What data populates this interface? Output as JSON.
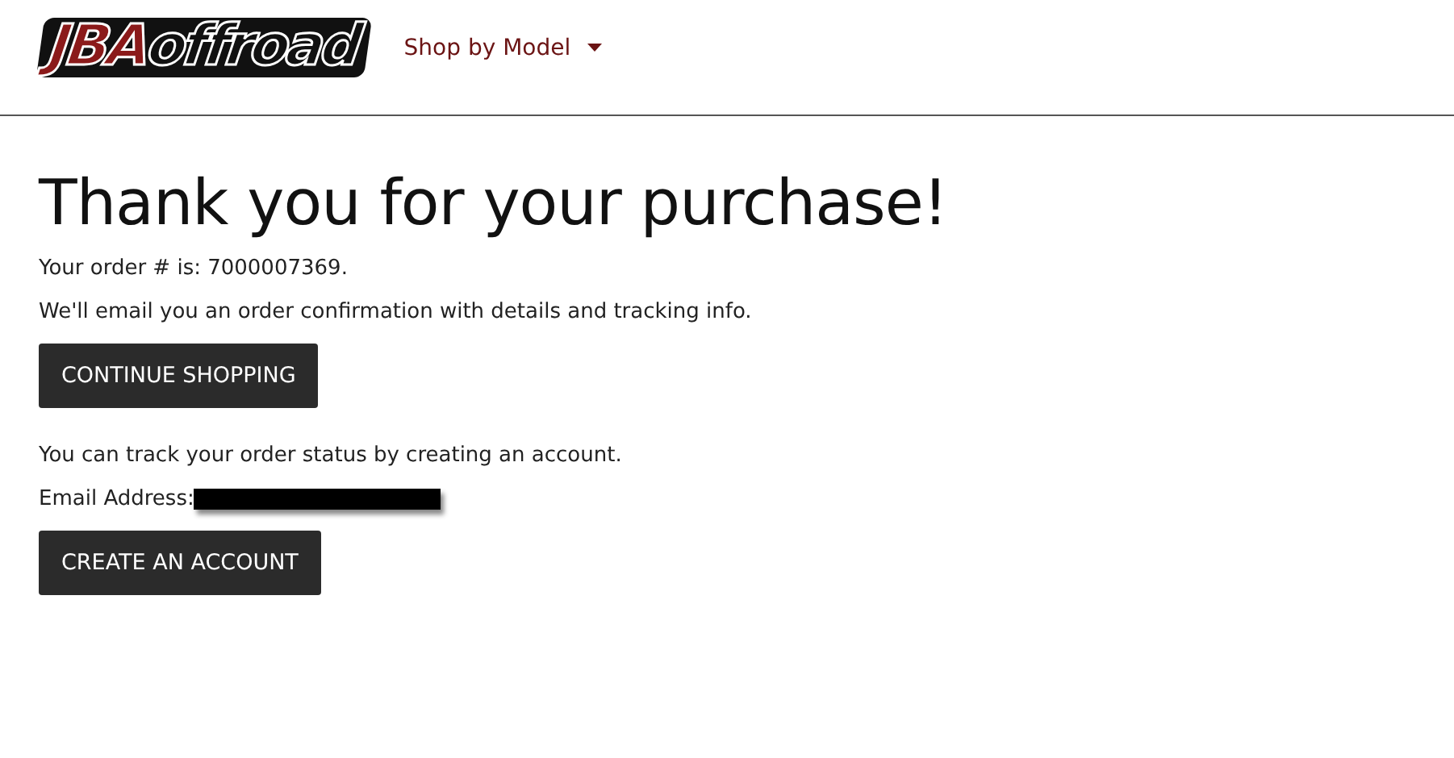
{
  "header": {
    "logo": {
      "accent": "JBA",
      "rest": "offroad"
    },
    "nav": [
      {
        "label": "Shop by Model",
        "has_menu": true
      }
    ]
  },
  "heading": "Thank you for your purchase!",
  "order_line": "Your order # is: 7000007369.",
  "email_note": "We'll email you an order confirmation with details and tracking info.",
  "continue_button": "CONTINUE SHOPPING",
  "track_note": "You can track your order status by creating an account.",
  "email_label": "Email Address:",
  "email_redacted": true,
  "create_button": "CREATE AN ACCOUNT"
}
